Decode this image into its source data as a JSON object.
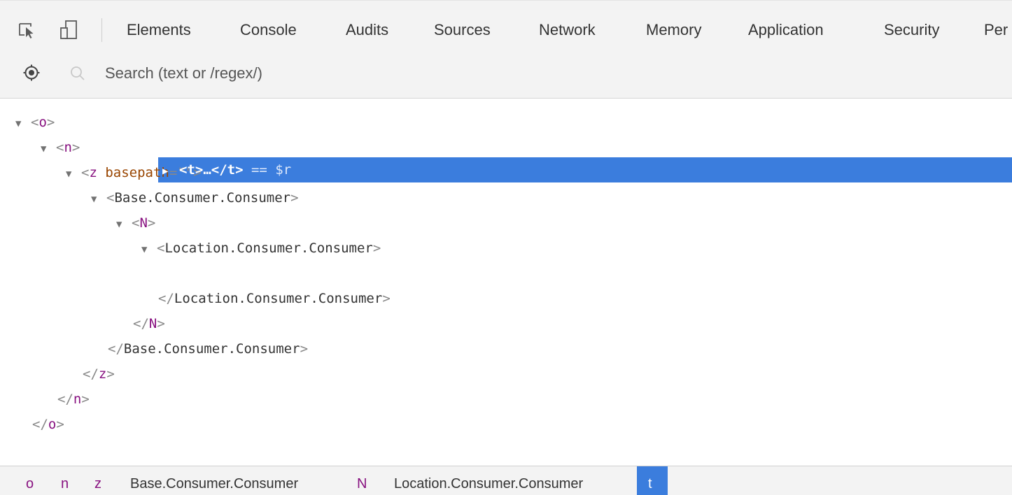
{
  "toolbar": {
    "tabs": [
      "Elements",
      "Console",
      "Audits",
      "Sources",
      "Network",
      "Memory",
      "Application",
      "Security",
      "Per"
    ]
  },
  "search": {
    "placeholder": "Search (text or /regex/)"
  },
  "tree": {
    "rows": [
      {
        "tri": "▼",
        "open": "<",
        "tag": "o",
        "close": ">"
      },
      {
        "tri": "▼",
        "open": "<",
        "tag": "n",
        "close": ">"
      },
      {
        "tri": "▼",
        "open": "<",
        "tag": "z",
        "attr_name": "basepath",
        "attr_eq": "=\"",
        "attr_val": "",
        "attr_end": "\">"
      },
      {
        "tri": "▼",
        "open": "<",
        "tag": "Base.Consumer.Consumer",
        "close": ">"
      },
      {
        "tri": "▼",
        "open": "<",
        "tag": "N",
        "close": ">"
      },
      {
        "tri": "▼",
        "open": "<",
        "tag": "Location.Consumer.Consumer",
        "close": ">"
      },
      {
        "tri": "▶",
        "text": "<t>…</t>",
        "suffix": " == $r"
      },
      {
        "open": "</",
        "tag": "Location.Consumer.Consumer",
        "close": ">"
      },
      {
        "open": "</",
        "tag": "N",
        "close": ">"
      },
      {
        "open": "</",
        "tag": "Base.Consumer.Consumer",
        "close": ">"
      },
      {
        "open": "</",
        "tag": "z",
        "close": ">"
      },
      {
        "open": "</",
        "tag": "n",
        "close": ">"
      },
      {
        "open": "</",
        "tag": "o",
        "close": ">"
      }
    ]
  },
  "breadcrumbs": [
    "o",
    "n",
    "z",
    "Base.Consumer.Consumer",
    "N",
    "Location.Consumer.Consumer",
    "t"
  ],
  "icons": {
    "inspect": "inspect-element-icon",
    "device": "device-toolbar-icon",
    "locate": "locate-node-icon",
    "search": "search-icon"
  },
  "colors": {
    "selection": "#3b7ddd",
    "tag": "#881280",
    "attr_name": "#994500",
    "toolbar_bg": "#f3f3f3"
  }
}
